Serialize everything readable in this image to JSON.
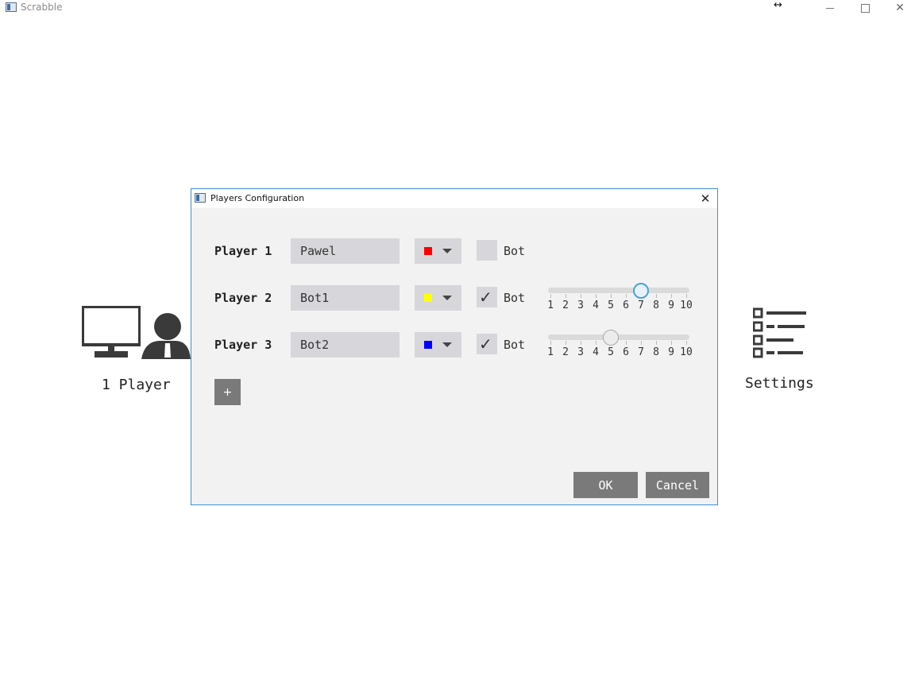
{
  "window": {
    "title": "Scrabble",
    "resize_indicator": "↔"
  },
  "background": {
    "one_player_label": "1 Player",
    "settings_label": "Settings"
  },
  "dialog": {
    "title": "Players Configuration",
    "close_glyph": "✕",
    "bot_label": "Bot",
    "add_label": "+",
    "ok_label": "OK",
    "cancel_label": "Cancel",
    "slider_min": 1,
    "slider_max": 10,
    "slider_ticks": [
      "1",
      "2",
      "3",
      "4",
      "5",
      "6",
      "7",
      "8",
      "9",
      "10"
    ],
    "players": [
      {
        "label": "Player 1",
        "name": "Pawel",
        "color": "#ff0000",
        "bot": false
      },
      {
        "label": "Player 2",
        "name": "Bot1",
        "color": "#ffff00",
        "bot": true,
        "difficulty": 7
      },
      {
        "label": "Player 3",
        "name": "Bot2",
        "color": "#0000ff",
        "bot": true,
        "difficulty": 5
      }
    ]
  }
}
